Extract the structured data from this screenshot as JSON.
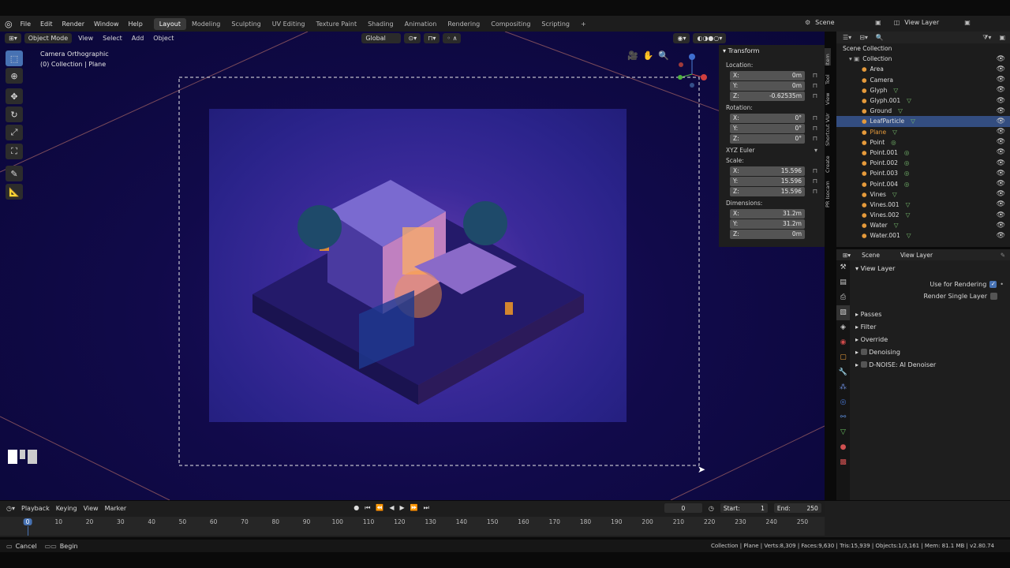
{
  "menu": [
    "File",
    "Edit",
    "Render",
    "Window",
    "Help"
  ],
  "workspaces": [
    "Layout",
    "Modeling",
    "Sculpting",
    "UV Editing",
    "Texture Paint",
    "Shading",
    "Animation",
    "Rendering",
    "Compositing",
    "Scripting",
    "+"
  ],
  "scene": "Scene",
  "view_layer": "View Layer",
  "viewport_header": {
    "mode": "Object Mode",
    "menus": [
      "View",
      "Select",
      "Add",
      "Object"
    ],
    "orientation": "Global"
  },
  "viewport_info": {
    "line1": "Camera Orthographic",
    "line2": "(0) Collection | Plane"
  },
  "npanel": {
    "title": "Transform",
    "location_label": "Location:",
    "location": [
      [
        "X:",
        "0m"
      ],
      [
        "Y:",
        "0m"
      ],
      [
        "Z:",
        "-0.62535m"
      ]
    ],
    "rotation_label": "Rotation:",
    "rotation": [
      [
        "X:",
        "0°"
      ],
      [
        "Y:",
        "0°"
      ],
      [
        "Z:",
        "0°"
      ]
    ],
    "rotation_mode": "XYZ Euler",
    "scale_label": "Scale:",
    "scale": [
      [
        "X:",
        "15.596"
      ],
      [
        "Y:",
        "15.596"
      ],
      [
        "Z:",
        "15.596"
      ]
    ],
    "dimensions_label": "Dimensions:",
    "dimensions": [
      [
        "X:",
        "31.2m"
      ],
      [
        "Y:",
        "31.2m"
      ],
      [
        "Z:",
        "0m"
      ]
    ],
    "tabs": [
      "Item",
      "Tool",
      "View",
      "Shortcut VUr",
      "Create",
      "PR Isocam"
    ]
  },
  "outliner": {
    "root": "Scene Collection",
    "items": [
      "Collection",
      "Area",
      "Camera",
      "Glyph",
      "Glyph.001",
      "Ground",
      "LeafParticle",
      "Plane",
      "Point",
      "Point.001",
      "Point.002",
      "Point.003",
      "Point.004",
      "Vines",
      "Vines.001",
      "Vines.002",
      "Water",
      "Water.001"
    ]
  },
  "props": {
    "header_scene": "Scene",
    "header_layer": "View Layer",
    "section": "View Layer",
    "use_for_rendering": "Use for Rendering",
    "render_single": "Render Single Layer",
    "panels": [
      "Passes",
      "Filter",
      "Override",
      "Denoising",
      "D-NOISE: AI Denoiser"
    ]
  },
  "timeline": {
    "menus": [
      "Playback",
      "Keying",
      "View",
      "Marker"
    ],
    "current": "0",
    "start_label": "Start:",
    "start": "1",
    "end_label": "End:",
    "end": "250",
    "ticks": [
      "0",
      "10",
      "20",
      "30",
      "40",
      "50",
      "60",
      "70",
      "80",
      "90",
      "100",
      "110",
      "120",
      "130",
      "140",
      "150",
      "160",
      "170",
      "180",
      "190",
      "200",
      "210",
      "220",
      "230",
      "240",
      "250"
    ]
  },
  "status": {
    "cancel": "Cancel",
    "begin": "Begin",
    "info": "Collection | Plane | Verts:8,309 | Faces:9,630 | Tris:15,939 | Objects:1/3,161 | Mem: 81.1 MB | v2.80.74"
  },
  "colors": {
    "accent": "#4772b3",
    "selected": "#334d80",
    "orange": "#e59a3b"
  }
}
